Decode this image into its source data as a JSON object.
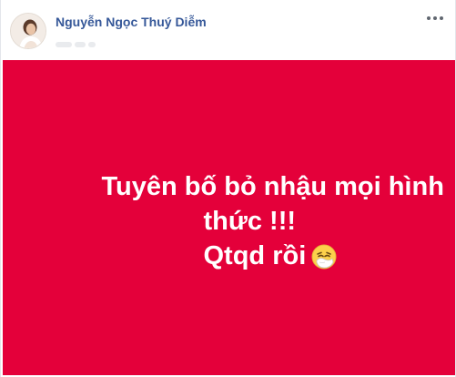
{
  "post": {
    "author_name": "Nguyễn Ngọc Thuý Diễm",
    "more_icon": "more-dots-icon",
    "avatar_icon": "profile-avatar",
    "status": {
      "background_color": "#e4003a",
      "line_1": "Tuyên bố bỏ nhậu mọi hình",
      "line_2": "thức !!!",
      "line_3": "Qtqd rồi",
      "emoji": "sneezing-face-emoji"
    }
  }
}
